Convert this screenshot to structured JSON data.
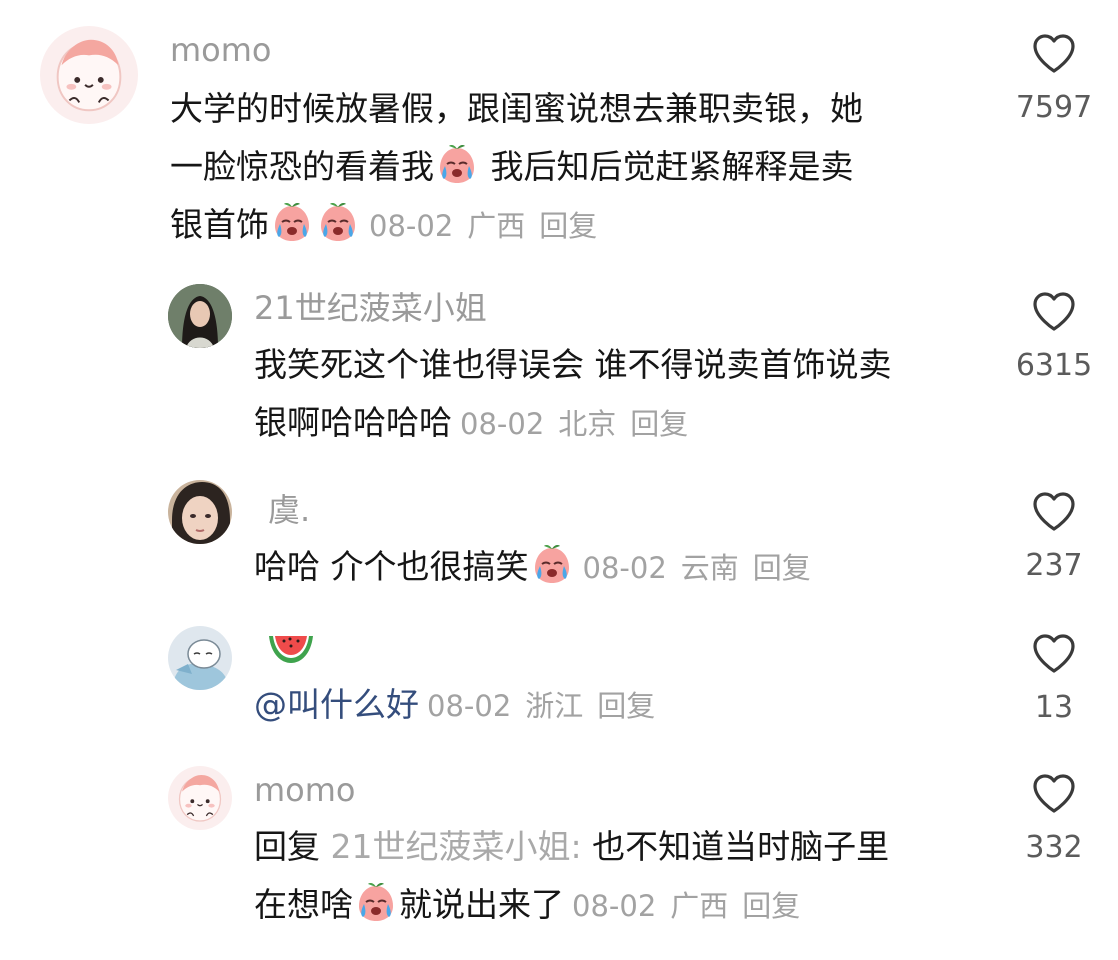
{
  "comments": [
    {
      "username": "momo",
      "lines": [
        "大学的时候放暑假，跟闺蜜说想去兼职卖银，她",
        "一脸惊恐的看着我",
        " 我后知后觉赶紧解释是卖",
        "银首饰"
      ],
      "date": "08-02",
      "location": "广西",
      "reply_label": "回复",
      "likes": "7597",
      "avatar_icon": "peach-cartoon-avatar"
    },
    {
      "username": "21世纪菠菜小姐",
      "lines": [
        "我笑死这个谁也得误会 谁不得说卖首饰说卖",
        "银啊哈哈哈哈"
      ],
      "date": "08-02",
      "location": "北京",
      "reply_label": "回复",
      "likes": "6315",
      "avatar_icon": "girl-photo-avatar"
    },
    {
      "username": "虞.",
      "lines": [
        "哈哈 介个也很搞笑"
      ],
      "date": "08-02",
      "location": "云南",
      "reply_label": "回复",
      "likes": "237",
      "avatar_icon": "face-photo-avatar"
    },
    {
      "username_icon": "watermelon-icon",
      "mention": "@叫什么好",
      "date": "08-02",
      "location": "浙江",
      "reply_label": "回复",
      "likes": "13",
      "avatar_icon": "cartoon-sleeping-avatar"
    },
    {
      "username": "momo",
      "reply_prefix": "回复",
      "reply_target": "21世纪菠菜小姐:",
      "lines": [
        " 也不知道当时脑子里",
        "在想啥",
        "就说出来了"
      ],
      "date": "08-02",
      "location": "广西",
      "reply_label": "回复",
      "likes": "332",
      "avatar_icon": "peach-cartoon-avatar"
    }
  ],
  "icons": {
    "like": "heart-outline-icon",
    "emoji": "crying-peach-emoji"
  },
  "colors": {
    "username": "#9a9a9a",
    "meta": "#a2a2a2",
    "mention": "#344d7c",
    "text": "#161616"
  }
}
